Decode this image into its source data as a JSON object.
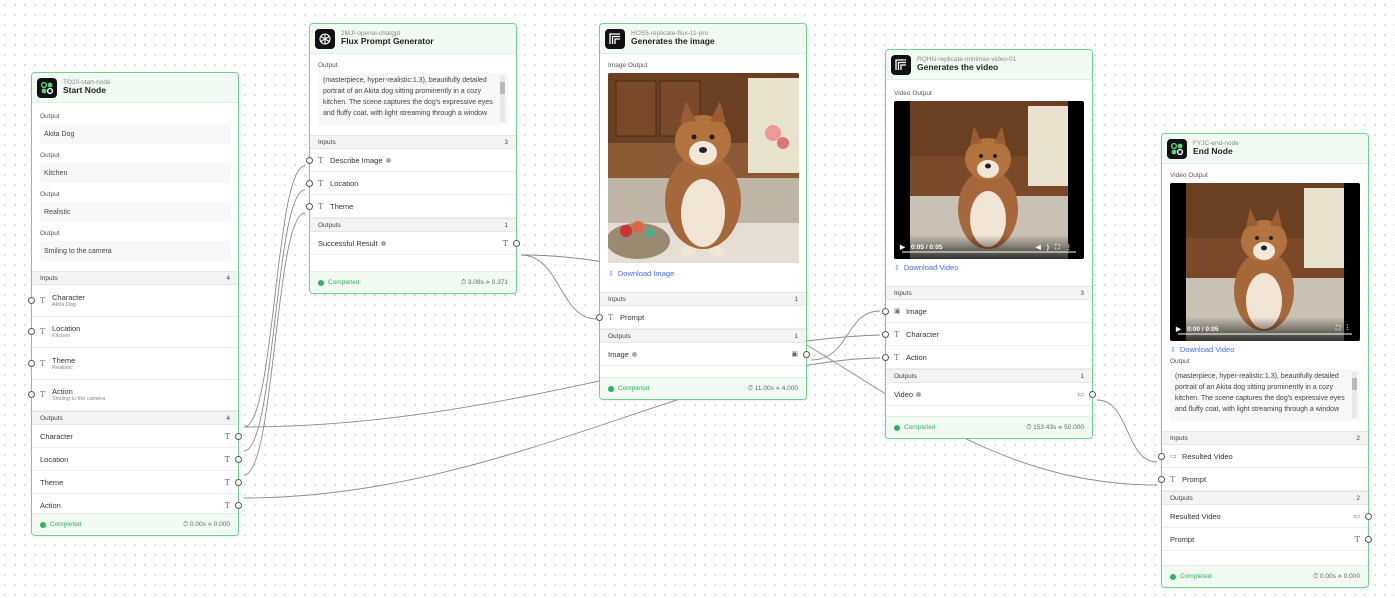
{
  "colors": {
    "accent": "#6fd38b",
    "status": "#2fb457",
    "link": "#4a6cf0"
  },
  "start_node": {
    "id": "TO20-start-node",
    "title": "Start Node",
    "output_label": "Output",
    "outputs": [
      "Akita Dog",
      "Kitchen",
      "Realistic",
      "Smiling to the camera"
    ],
    "inputs_label": "Inputs",
    "inputs_count": "4",
    "inputs": [
      {
        "label": "Character",
        "sub": "Akita Dog"
      },
      {
        "label": "Location",
        "sub": "Kitchen"
      },
      {
        "label": "Theme",
        "sub": "Realistic"
      },
      {
        "label": "Action",
        "sub": "Smiling to the camera"
      }
    ],
    "outputs_label": "Outputs",
    "outputs_count": "4",
    "output_ports": [
      "Character",
      "Location",
      "Theme",
      "Action"
    ],
    "status": "Completed",
    "stats": "⏱ 0.00s  ⟡ 0.000"
  },
  "flux_prompt": {
    "id": "2MJI-openai-chatgpt",
    "title": "Flux Prompt Generator",
    "output_label": "Output",
    "output_text": "(masterpiece, hyper-realistic:1.3), beautifully detailed portrait of an Akita dog sitting prominently in a cozy kitchen. The scene captures the dog's expressive eyes and fluffy coat, with light streaming through a window",
    "inputs_label": "Inputs",
    "inputs_count": "3",
    "inputs": [
      "Describe Image",
      "Location",
      "Theme"
    ],
    "outputs_label": "Outputs",
    "outputs_count": "1",
    "output_ports": [
      "Successful Result"
    ],
    "status": "Completed",
    "stats": "⏱ 3.08s  ⟡ 0.371"
  },
  "gen_image": {
    "id": "HOS5-replicate-flux-11-pro",
    "title": "Generates the image",
    "image_output_label": "Image Output",
    "download": "Download Image",
    "inputs_label": "Inputs",
    "inputs_count": "1",
    "inputs": [
      "Prompt"
    ],
    "outputs_label": "Outputs",
    "outputs_count": "1",
    "output_ports": [
      "Image"
    ],
    "status": "Completed",
    "stats": "⏱ 11.00s  ⟡ 4.000"
  },
  "gen_video": {
    "id": "RQHN-replicate-minimax-video-01",
    "title": "Generates the video",
    "video_output_label": "Video Output",
    "video_time": "0:05 / 0:05",
    "download": "Download Video",
    "inputs_label": "Inputs",
    "inputs_count": "3",
    "inputs": [
      "Image",
      "Character",
      "Action"
    ],
    "outputs_label": "Outputs",
    "outputs_count": "1",
    "output_ports": [
      "Video"
    ],
    "status": "Completed",
    "stats": "⏱ 153.43s  ⟡ 50.000"
  },
  "end_node": {
    "id": "FYJC-end-node",
    "title": "End Node",
    "video_output_label": "Video Output",
    "video_time": "0:00 / 0:05",
    "download": "Download Video",
    "output_label": "Output",
    "output_text": "(masterpiece, hyper-realistic:1.3), beautifully detailed portrait of an Akita dog sitting prominently in a cozy kitchen. The scene captures the dog's expressive eyes and fluffy coat, with light streaming through a window",
    "inputs_label": "Inputs",
    "inputs_count": "2",
    "inputs": [
      "Resulted Video",
      "Prompt"
    ],
    "outputs_label": "Outputs",
    "outputs_count": "2",
    "output_ports": [
      "Resulted Video",
      "Prompt"
    ],
    "status": "Completed",
    "stats": "⏱ 0.00s  ⟡ 0.000"
  }
}
